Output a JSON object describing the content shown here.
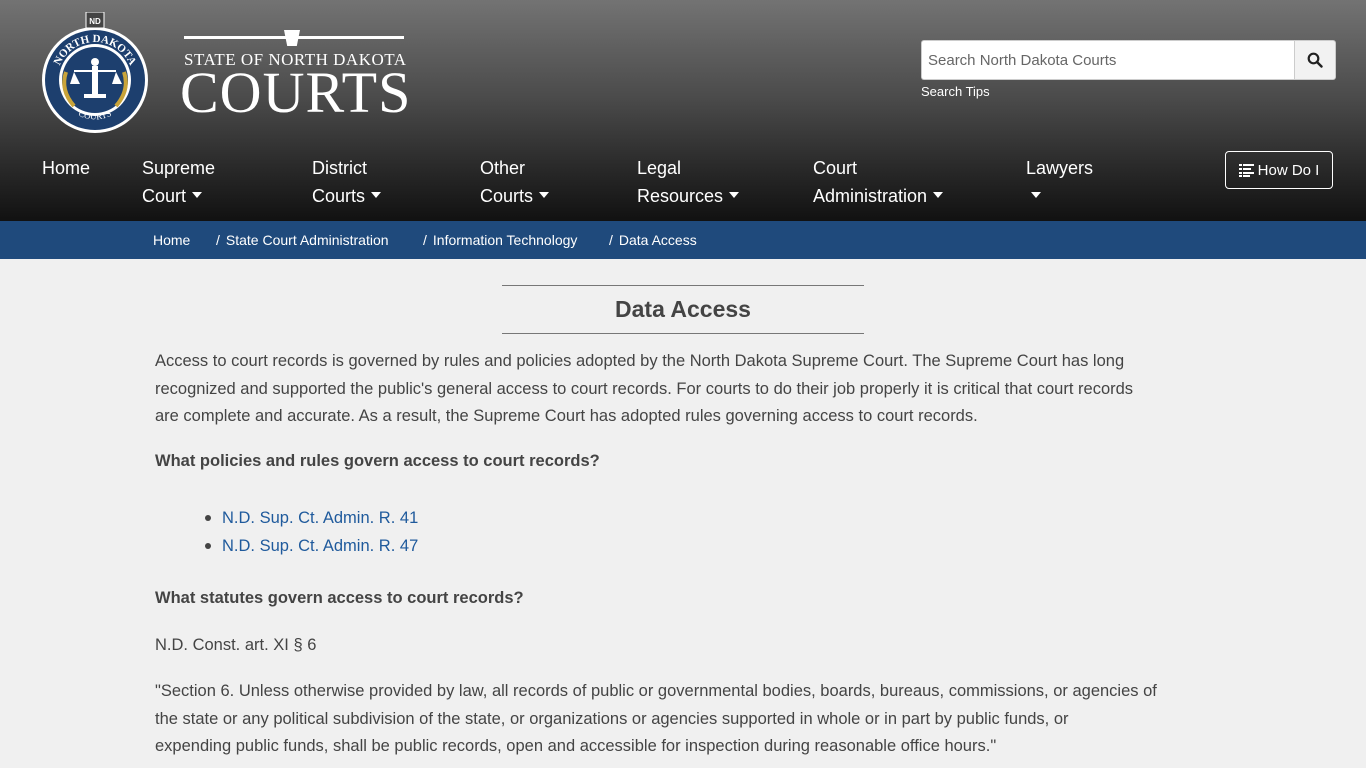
{
  "header": {
    "seal_text_top": "NORTH DAKOTA",
    "seal_text_bottom": "COURTS",
    "seal_badge": "ND",
    "wordmark_top": "STATE OF NORTH DAKOTA",
    "wordmark_main": "COURTS",
    "search_placeholder": "Search North Dakota Courts",
    "search_tips": "Search Tips",
    "how_do_i": "How Do I"
  },
  "nav": {
    "items": [
      {
        "line1": "Home",
        "line2": ""
      },
      {
        "line1": "Supreme",
        "line2": "Court"
      },
      {
        "line1": "District",
        "line2": "Courts"
      },
      {
        "line1": "Other",
        "line2": "Courts"
      },
      {
        "line1": "Legal",
        "line2": "Resources"
      },
      {
        "line1": "Court",
        "line2": "Administration"
      },
      {
        "line1": "Lawyers",
        "line2": ""
      }
    ]
  },
  "breadcrumb": {
    "items": [
      "Home",
      "State Court Administration",
      "Information Technology",
      "Data Access"
    ],
    "separator": "/"
  },
  "main": {
    "title": "Data Access",
    "intro_line1": "Access to court records is governed by rules and policies adopted by the North Dakota Supreme Court. The Supreme Court has long",
    "intro_line2": "recognized and supported the public's general access to court records. For courts to do their job properly it is critical that court records",
    "intro_line3": "are complete and accurate. As a result, the Supreme Court has adopted rules governing access to court records.",
    "q1": "What policies and rules govern access to court records?",
    "rules": [
      "N.D. Sup. Ct. Admin. R. 41",
      "N.D. Sup. Ct. Admin. R. 47"
    ],
    "q2": "What statutes govern access to court records?",
    "statute": "N.D. Const. art. XI § 6",
    "quote_line1": "\"Section 6. Unless otherwise provided by law, all records of public or governmental bodies, boards, bureaus, commissions, or agencies of",
    "quote_line2": "the state or any political subdivision of the state, or organizations or agencies supported in whole or in part by public funds, or",
    "quote_line3": "expending public funds, shall be public records, open and accessible for inspection during reasonable office hours.\""
  },
  "colors": {
    "breadcrumb_bg": "#1f4a7c",
    "link": "#1f5a9c",
    "seal_blue": "#1d3f6e",
    "seal_gold": "#c9a43a"
  }
}
